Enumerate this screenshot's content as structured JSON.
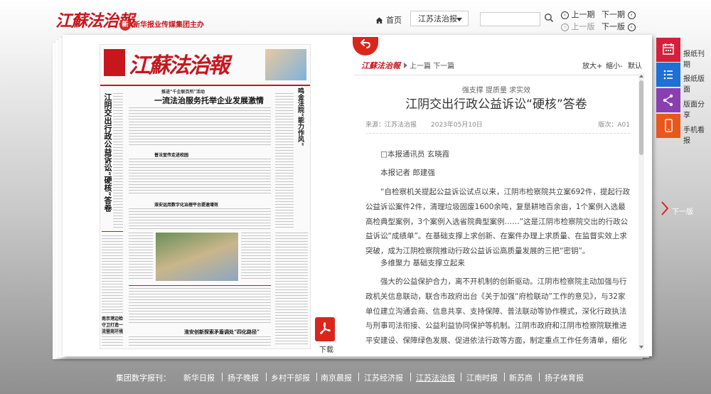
{
  "header": {
    "logo_text": "江蘇法治報",
    "logo_sub_mark": "新华",
    "logo_sub": "新华报业传媒集团主办",
    "home_label": "首页",
    "paper_select": "江苏法治报",
    "search_value": "",
    "prev_issue": "上一期",
    "next_issue": "下一期",
    "prev_page": "上一版",
    "next_page": "下一版"
  },
  "thumbnail": {
    "masthead": "江蘇法治報",
    "left_vertical": "江阴交出行政公益诉讼“硬核”答卷",
    "lead_headline": "一流法治服务托举企业发展激情",
    "lead_kicker": "推进“千企联百所”活动",
    "right_vertical": "鸣金法院“能力作风”",
    "second_headline": "普法宣传走进校园",
    "third_headline": "淮安运用数字化治理平台提速增效",
    "bottom_headline": "淮安创新探索矛盾调处“四化路径”",
    "left_bottom": "南京港边检守卫打造一流营商环境"
  },
  "download_label": "下载",
  "article_toolbar": {
    "logo": "江蘇法治報",
    "prev_article": "上一篇",
    "next_article": "下一篇",
    "zoom_in": "放大+",
    "zoom_out": "缩小-",
    "default": "默认"
  },
  "article": {
    "subtitle": "强支撑 提质量 求实效",
    "title": "江阴交出行政公益诉讼“硬核”答卷",
    "source": "来源：江苏法治报",
    "date": "2023年05月10日",
    "edition": "版次：A01",
    "p1": "□本报通讯员 玄晓霞",
    "p2": "本报记者 郎建强",
    "p3": "“自检察机关提起公益诉讼试点以来，江阴市检察院共立案692件，提起行政公益诉讼案件2件，清理垃圾固废1600余吨，复垦耕地百余亩，1个案例入选最高检典型案例，3个案例入选省院典型案例……”这是江阴市检察院交出的行政公益诉讼“成绩单”。在基础支撑上求创新、在案件办理上求质量、在监督实效上求突破，成为江阴检察院推动行政公益诉讼高质量发展的三把“密钥”。",
    "p4": "多维聚力 基础支撑立起来",
    "p5": "强大的公益保护合力，离不开机制的创新驱动。江阴市检察院主动加强与行政机关信息联动，联合市政府出台《关于加强“府检联动”工作的意见》，与32家单位建立沟通会商、信息共享、支持保障、普法联动等协作模式，深化行政执法与刑事司法衔接、公益利益协同保护等机制。江阴市政府和江阴市检察院联推进平安建设、保障绿色发展、促进依法行政等方面，制定重点工作任务清单，细化工作安排和要求，形成“一张清单”“一张路线图”推进工作落实。"
  },
  "sidebar": {
    "items": [
      {
        "label": "报纸刊期",
        "icon": "calendar-icon",
        "color": "#d4203a"
      },
      {
        "label": "报纸版面",
        "icon": "list-icon",
        "color": "#1e6fd6"
      },
      {
        "label": "版面分享",
        "icon": "share-icon",
        "color": "#8a3fb0"
      },
      {
        "label": "手机看报",
        "icon": "mobile-icon",
        "color": "#e8571c"
      }
    ],
    "next_label": "下一版"
  },
  "footer": {
    "label": "集团数字报刊：",
    "links": [
      "新华日报",
      "扬子晚报",
      "乡村干部报",
      "南京晨报",
      "江苏经济报",
      "江苏法治报",
      "江南时报",
      "新苏商",
      "扬子体育报"
    ]
  }
}
